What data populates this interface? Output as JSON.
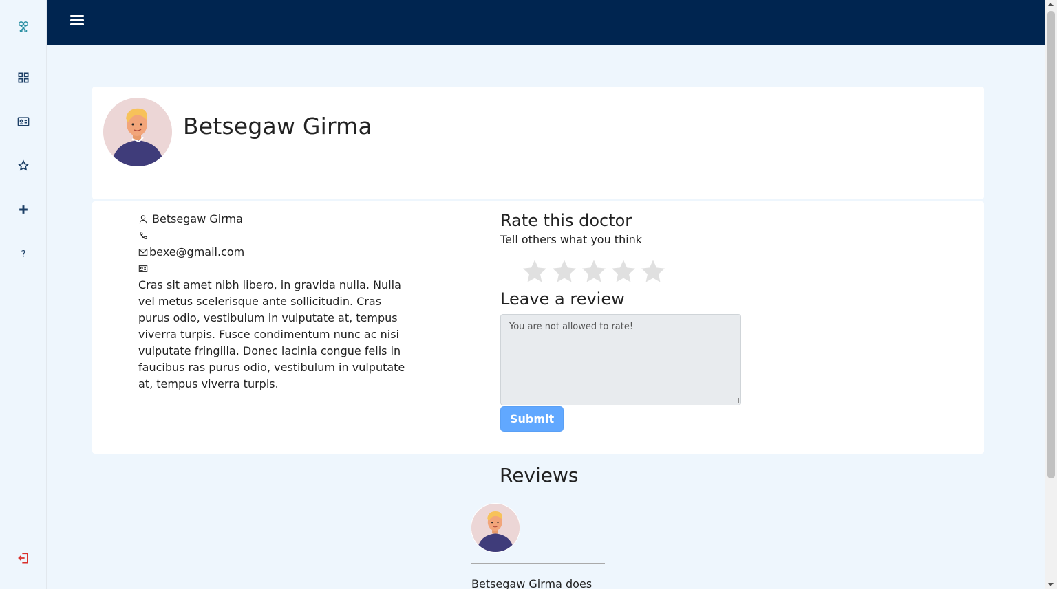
{
  "sidebar": {
    "items": [
      {
        "icon": "logo-icon"
      },
      {
        "icon": "dashboard-grid-icon"
      },
      {
        "icon": "id-card-icon"
      },
      {
        "icon": "star-icon"
      },
      {
        "icon": "plus-icon"
      },
      {
        "icon": "help-icon"
      },
      {
        "icon": "logout-icon"
      }
    ]
  },
  "topbar": {
    "menu_icon": "hamburger-icon",
    "color": "#002550"
  },
  "doctor": {
    "name": "Betsegaw Girma",
    "contact_name": "Betsegaw Girma",
    "phone": "",
    "email": "bexe@gmail.com",
    "bio": "Cras sit amet nibh libero, in gravida nulla. Nulla vel metus scelerisque ante sollicitudin. Cras purus odio, vestibulum in vulputate at, tempus viverra turpis. Fusce condimentum nunc ac nisi vulputate fringilla. Donec lacinia congue felis in faucibus ras purus odio, vestibulum in vulputate at, tempus viverra turpis."
  },
  "rating": {
    "title": "Rate this doctor",
    "subtitle": "Tell others what you think",
    "stars_total": 5,
    "stars_selected": 0
  },
  "review_form": {
    "title": "Leave a review",
    "placeholder": "You are not allowed to rate!",
    "submit_label": "Submit"
  },
  "reviews": {
    "title": "Reviews",
    "items": [
      {
        "text": "Betsegaw Girma does"
      }
    ]
  },
  "colors": {
    "accent": "#61a8ff",
    "topbar": "#002550",
    "logout": "#d9302c",
    "icon": "#1c3f66"
  }
}
